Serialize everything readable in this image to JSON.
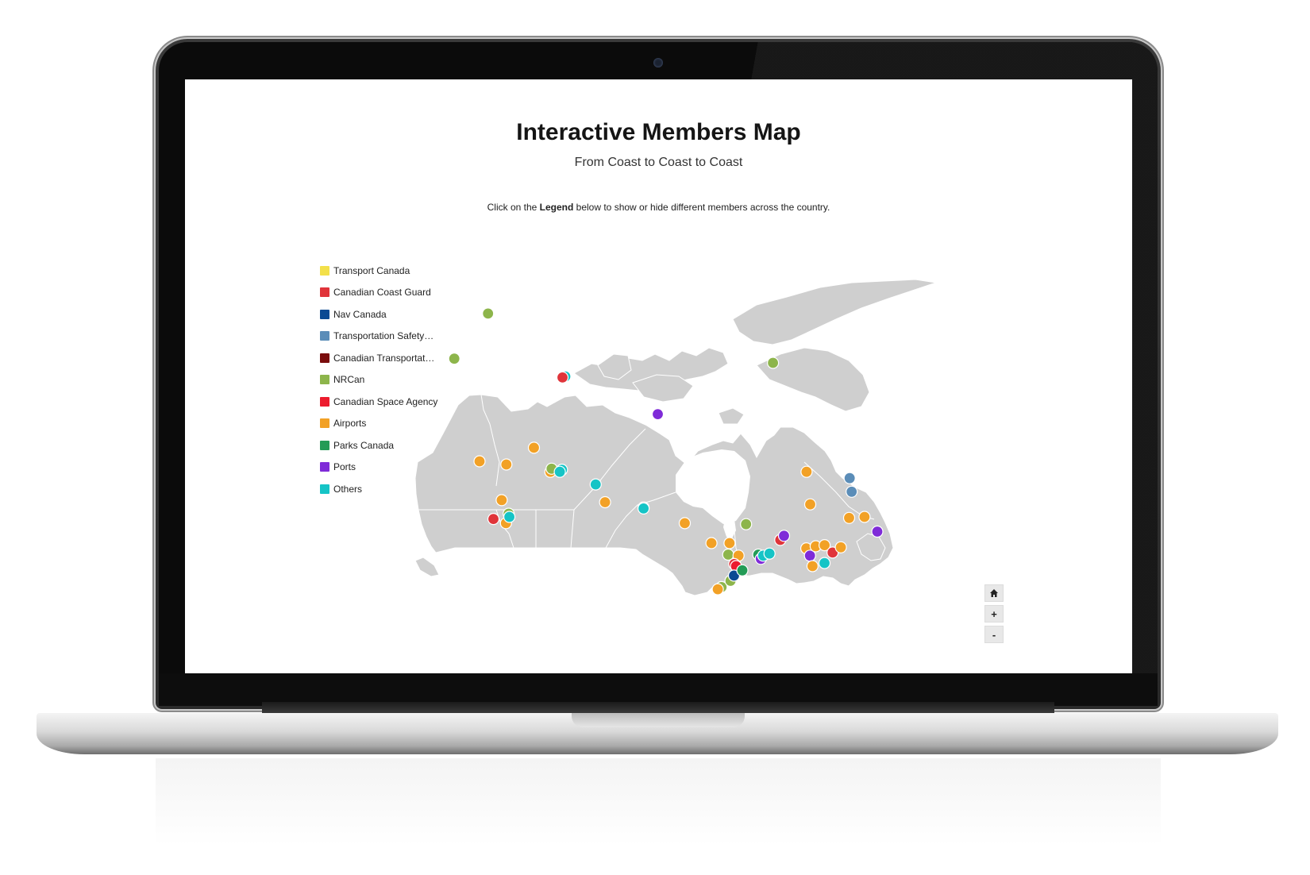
{
  "page": {
    "title": "Interactive Members Map",
    "subtitle": "From Coast to Coast to Coast",
    "instruction_before": "Click on the ",
    "instruction_bold": "Legend",
    "instruction_after": " below to show or hide different members across the country."
  },
  "legend": [
    {
      "label": "Transport Canada",
      "color": "#f3e04a"
    },
    {
      "label": "Canadian Coast Guard",
      "color": "#e0343a"
    },
    {
      "label": "Nav Canada",
      "color": "#0a4a93"
    },
    {
      "label": "Transportation Safety…",
      "color": "#5b8db8"
    },
    {
      "label": "Canadian Transportat…",
      "color": "#7a0c0c"
    },
    {
      "label": "NRCan",
      "color": "#8db54b"
    },
    {
      "label": "Canadian Space Agency",
      "color": "#ec1c2e"
    },
    {
      "label": "Airports",
      "color": "#f2a126"
    },
    {
      "label": "Parks Canada",
      "color": "#239b56"
    },
    {
      "label": "Ports",
      "color": "#7f2bd8"
    },
    {
      "label": "Others",
      "color": "#15c4c6"
    }
  ],
  "map": {
    "land_color": "#cfcfcf",
    "border_color": "#ffffff",
    "markers": [
      {
        "category": "NRCan",
        "lon": -139.5,
        "lat": 64.1
      },
      {
        "category": "NRCan",
        "lon": -133.7,
        "lat": 68.4
      },
      {
        "category": "NRCan",
        "lon": -68.5,
        "lat": 63.7
      },
      {
        "category": "Others",
        "lon": -114.4,
        "lat": 62.4
      },
      {
        "category": "Canadian Coast Guard",
        "lon": -115.0,
        "lat": 62.3
      },
      {
        "category": "Ports",
        "lon": -94.2,
        "lat": 58.8
      },
      {
        "category": "Airports",
        "lon": -130.3,
        "lat": 54.3
      },
      {
        "category": "Airports",
        "lon": -124.8,
        "lat": 54.0
      },
      {
        "category": "Airports",
        "lon": -119.6,
        "lat": 55.6
      },
      {
        "category": "Airports",
        "lon": -115.8,
        "lat": 53.3
      },
      {
        "category": "NRCan",
        "lon": -115.6,
        "lat": 53.6
      },
      {
        "category": "Others",
        "lon": -113.5,
        "lat": 53.5
      },
      {
        "category": "Others",
        "lon": -113.9,
        "lat": 53.3
      },
      {
        "category": "Airports",
        "lon": -124.8,
        "lat": 50.6
      },
      {
        "category": "Canadian Coast Guard",
        "lon": -125.9,
        "lat": 48.8
      },
      {
        "category": "Airports",
        "lon": -123.4,
        "lat": 48.4
      },
      {
        "category": "NRCan",
        "lon": -123.1,
        "lat": 49.3
      },
      {
        "category": "Others",
        "lon": -122.9,
        "lat": 49.0
      },
      {
        "category": "Others",
        "lon": -106.6,
        "lat": 52.1
      },
      {
        "category": "Airports",
        "lon": -104.6,
        "lat": 50.4
      },
      {
        "category": "Canadian Coast Guard",
        "lon": -97.1,
        "lat": 49.9
      },
      {
        "category": "Others",
        "lon": -97.1,
        "lat": 49.8
      },
      {
        "category": "Airports",
        "lon": -89.2,
        "lat": 48.4
      },
      {
        "category": "Airports",
        "lon": -84.3,
        "lat": 46.5
      },
      {
        "category": "Airports",
        "lon": -80.9,
        "lat": 46.5
      },
      {
        "category": "NRCan",
        "lon": -77.5,
        "lat": 48.3
      },
      {
        "category": "NRCan",
        "lon": -81.3,
        "lat": 45.4
      },
      {
        "category": "Airports",
        "lon": -79.4,
        "lat": 45.3
      },
      {
        "category": "Canadian Coast Guard",
        "lon": -80.3,
        "lat": 44.5
      },
      {
        "category": "Canadian Space Agency",
        "lon": -80.0,
        "lat": 44.3
      },
      {
        "category": "NRCan",
        "lon": -82.9,
        "lat": 42.3
      },
      {
        "category": "Airports",
        "lon": -83.6,
        "lat": 42.1
      },
      {
        "category": "NRCan",
        "lon": -81.2,
        "lat": 42.9
      },
      {
        "category": "Nav Canada",
        "lon": -80.5,
        "lat": 43.4
      },
      {
        "category": "Parks Canada",
        "lon": -78.9,
        "lat": 43.9
      },
      {
        "category": "Parks Canada",
        "lon": -75.7,
        "lat": 45.4
      },
      {
        "category": "Ports",
        "lon": -75.3,
        "lat": 45.0
      },
      {
        "category": "Others",
        "lon": -74.8,
        "lat": 45.3
      },
      {
        "category": "Others",
        "lon": -73.6,
        "lat": 45.5
      },
      {
        "category": "Canadian Coast Guard",
        "lon": -71.3,
        "lat": 46.8
      },
      {
        "category": "Ports",
        "lon": -70.5,
        "lat": 47.2
      },
      {
        "category": "Airports",
        "lon": -64.5,
        "lat": 53.3
      },
      {
        "category": "Airports",
        "lon": -64.7,
        "lat": 50.2
      },
      {
        "category": "Transportation Safety…",
        "lon": -56.1,
        "lat": 52.7
      },
      {
        "category": "Transportation Safety…",
        "lon": -56.2,
        "lat": 51.4
      },
      {
        "category": "Airports",
        "lon": -66.6,
        "lat": 46.0
      },
      {
        "category": "Ports",
        "lon": -66.1,
        "lat": 45.3
      },
      {
        "category": "Airports",
        "lon": -65.9,
        "lat": 44.3
      },
      {
        "category": "Airports",
        "lon": -64.8,
        "lat": 46.2
      },
      {
        "category": "Airports",
        "lon": -63.1,
        "lat": 46.3
      },
      {
        "category": "Others",
        "lon": -63.6,
        "lat": 44.6
      },
      {
        "category": "Canadian Coast Guard",
        "lon": -61.8,
        "lat": 45.6
      },
      {
        "category": "Airports",
        "lon": -60.1,
        "lat": 46.1
      },
      {
        "category": "Airports",
        "lon": -57.6,
        "lat": 48.9
      },
      {
        "category": "Airports",
        "lon": -54.6,
        "lat": 49.0
      },
      {
        "category": "Ports",
        "lon": -52.7,
        "lat": 47.6
      }
    ]
  },
  "controls": {
    "home_icon": "home-icon",
    "zoom_in_label": "+",
    "zoom_out_label": "-"
  }
}
